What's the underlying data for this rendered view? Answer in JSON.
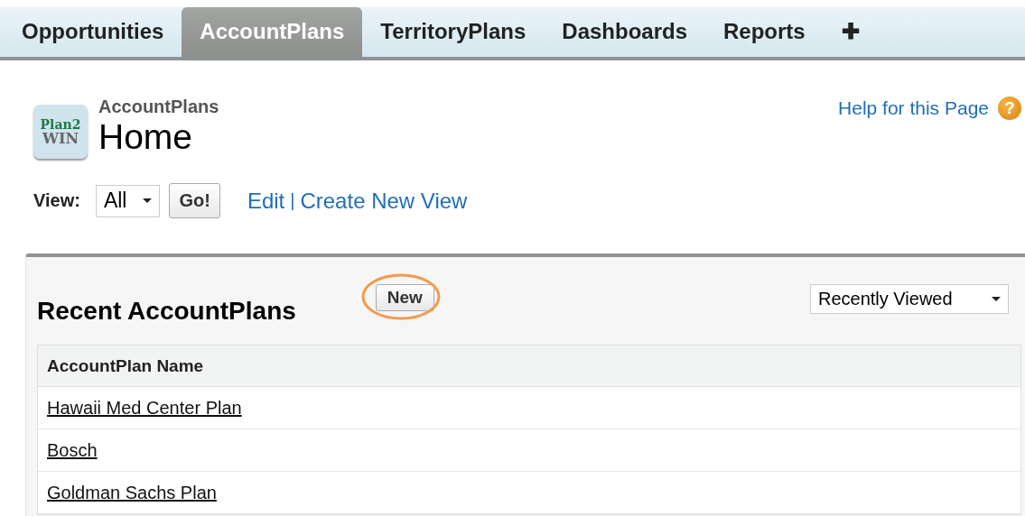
{
  "tabs": [
    {
      "label": "Opportunities",
      "selected": false
    },
    {
      "label": "AccountPlans",
      "selected": true
    },
    {
      "label": "TerritoryPlans",
      "selected": false
    },
    {
      "label": "Dashboards",
      "selected": false
    },
    {
      "label": "Reports",
      "selected": false
    },
    {
      "label": "✚",
      "selected": false
    }
  ],
  "header": {
    "logo": {
      "line_1": "Plan2",
      "line_2": "WIN"
    },
    "object": "AccountPlans",
    "title": "Home",
    "help_link": "Help for this Page",
    "help_icon": "?"
  },
  "view": {
    "label": "View:",
    "value": "All",
    "go_button": "Go!",
    "links": [
      "Edit",
      "Create New View"
    ],
    "separator": "|"
  },
  "recent": {
    "title": "Recent AccountPlans",
    "new_button": "New",
    "new_highlighted": true,
    "filter": "Recently Viewed",
    "columns": [
      "AccountPlan Name"
    ],
    "rows": [
      "Hawaii Med Center Plan",
      "Bosch",
      "Goldman Sachs Plan"
    ]
  }
}
